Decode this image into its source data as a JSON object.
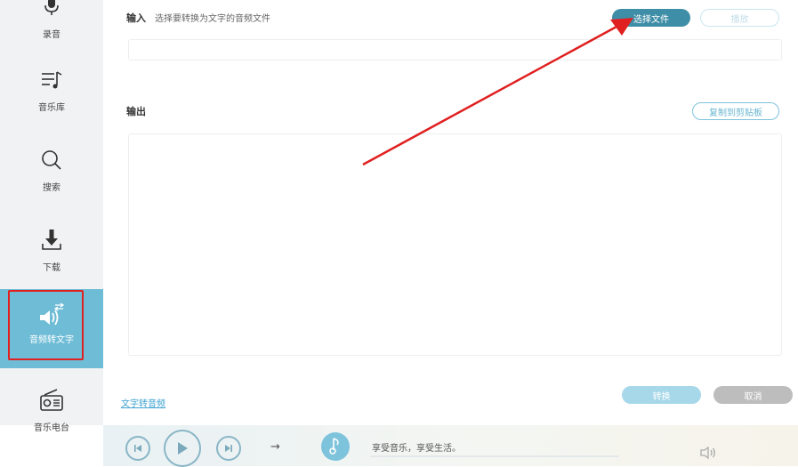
{
  "sidebar": {
    "items": [
      {
        "label": "录音",
        "icon": "microphone-icon"
      },
      {
        "label": "音乐库",
        "icon": "music-list-icon"
      },
      {
        "label": "搜索",
        "icon": "search-icon"
      },
      {
        "label": "下载",
        "icon": "download-icon"
      },
      {
        "label": "音频转文字",
        "icon": "audio-to-text-icon",
        "active": true
      },
      {
        "label": "音乐电台",
        "icon": "radio-icon"
      }
    ]
  },
  "input_section": {
    "title": "输入",
    "hint": "选择要转换为文字的音频文件",
    "choose_file_label": "选择文件",
    "play_label": "播放"
  },
  "output_section": {
    "title": "输出",
    "copy_label": "复制到剪贴板"
  },
  "footer": {
    "text_to_audio_link": "文字转音频",
    "convert_label": "转换",
    "cancel_label": "取消"
  },
  "player": {
    "tagline": "享受音乐，享受生活。",
    "arrow_glyph": "→"
  },
  "colors": {
    "accent": "#3f8ea7",
    "active_nav": "#6fbcd6",
    "annotation_red": "#e02020"
  }
}
